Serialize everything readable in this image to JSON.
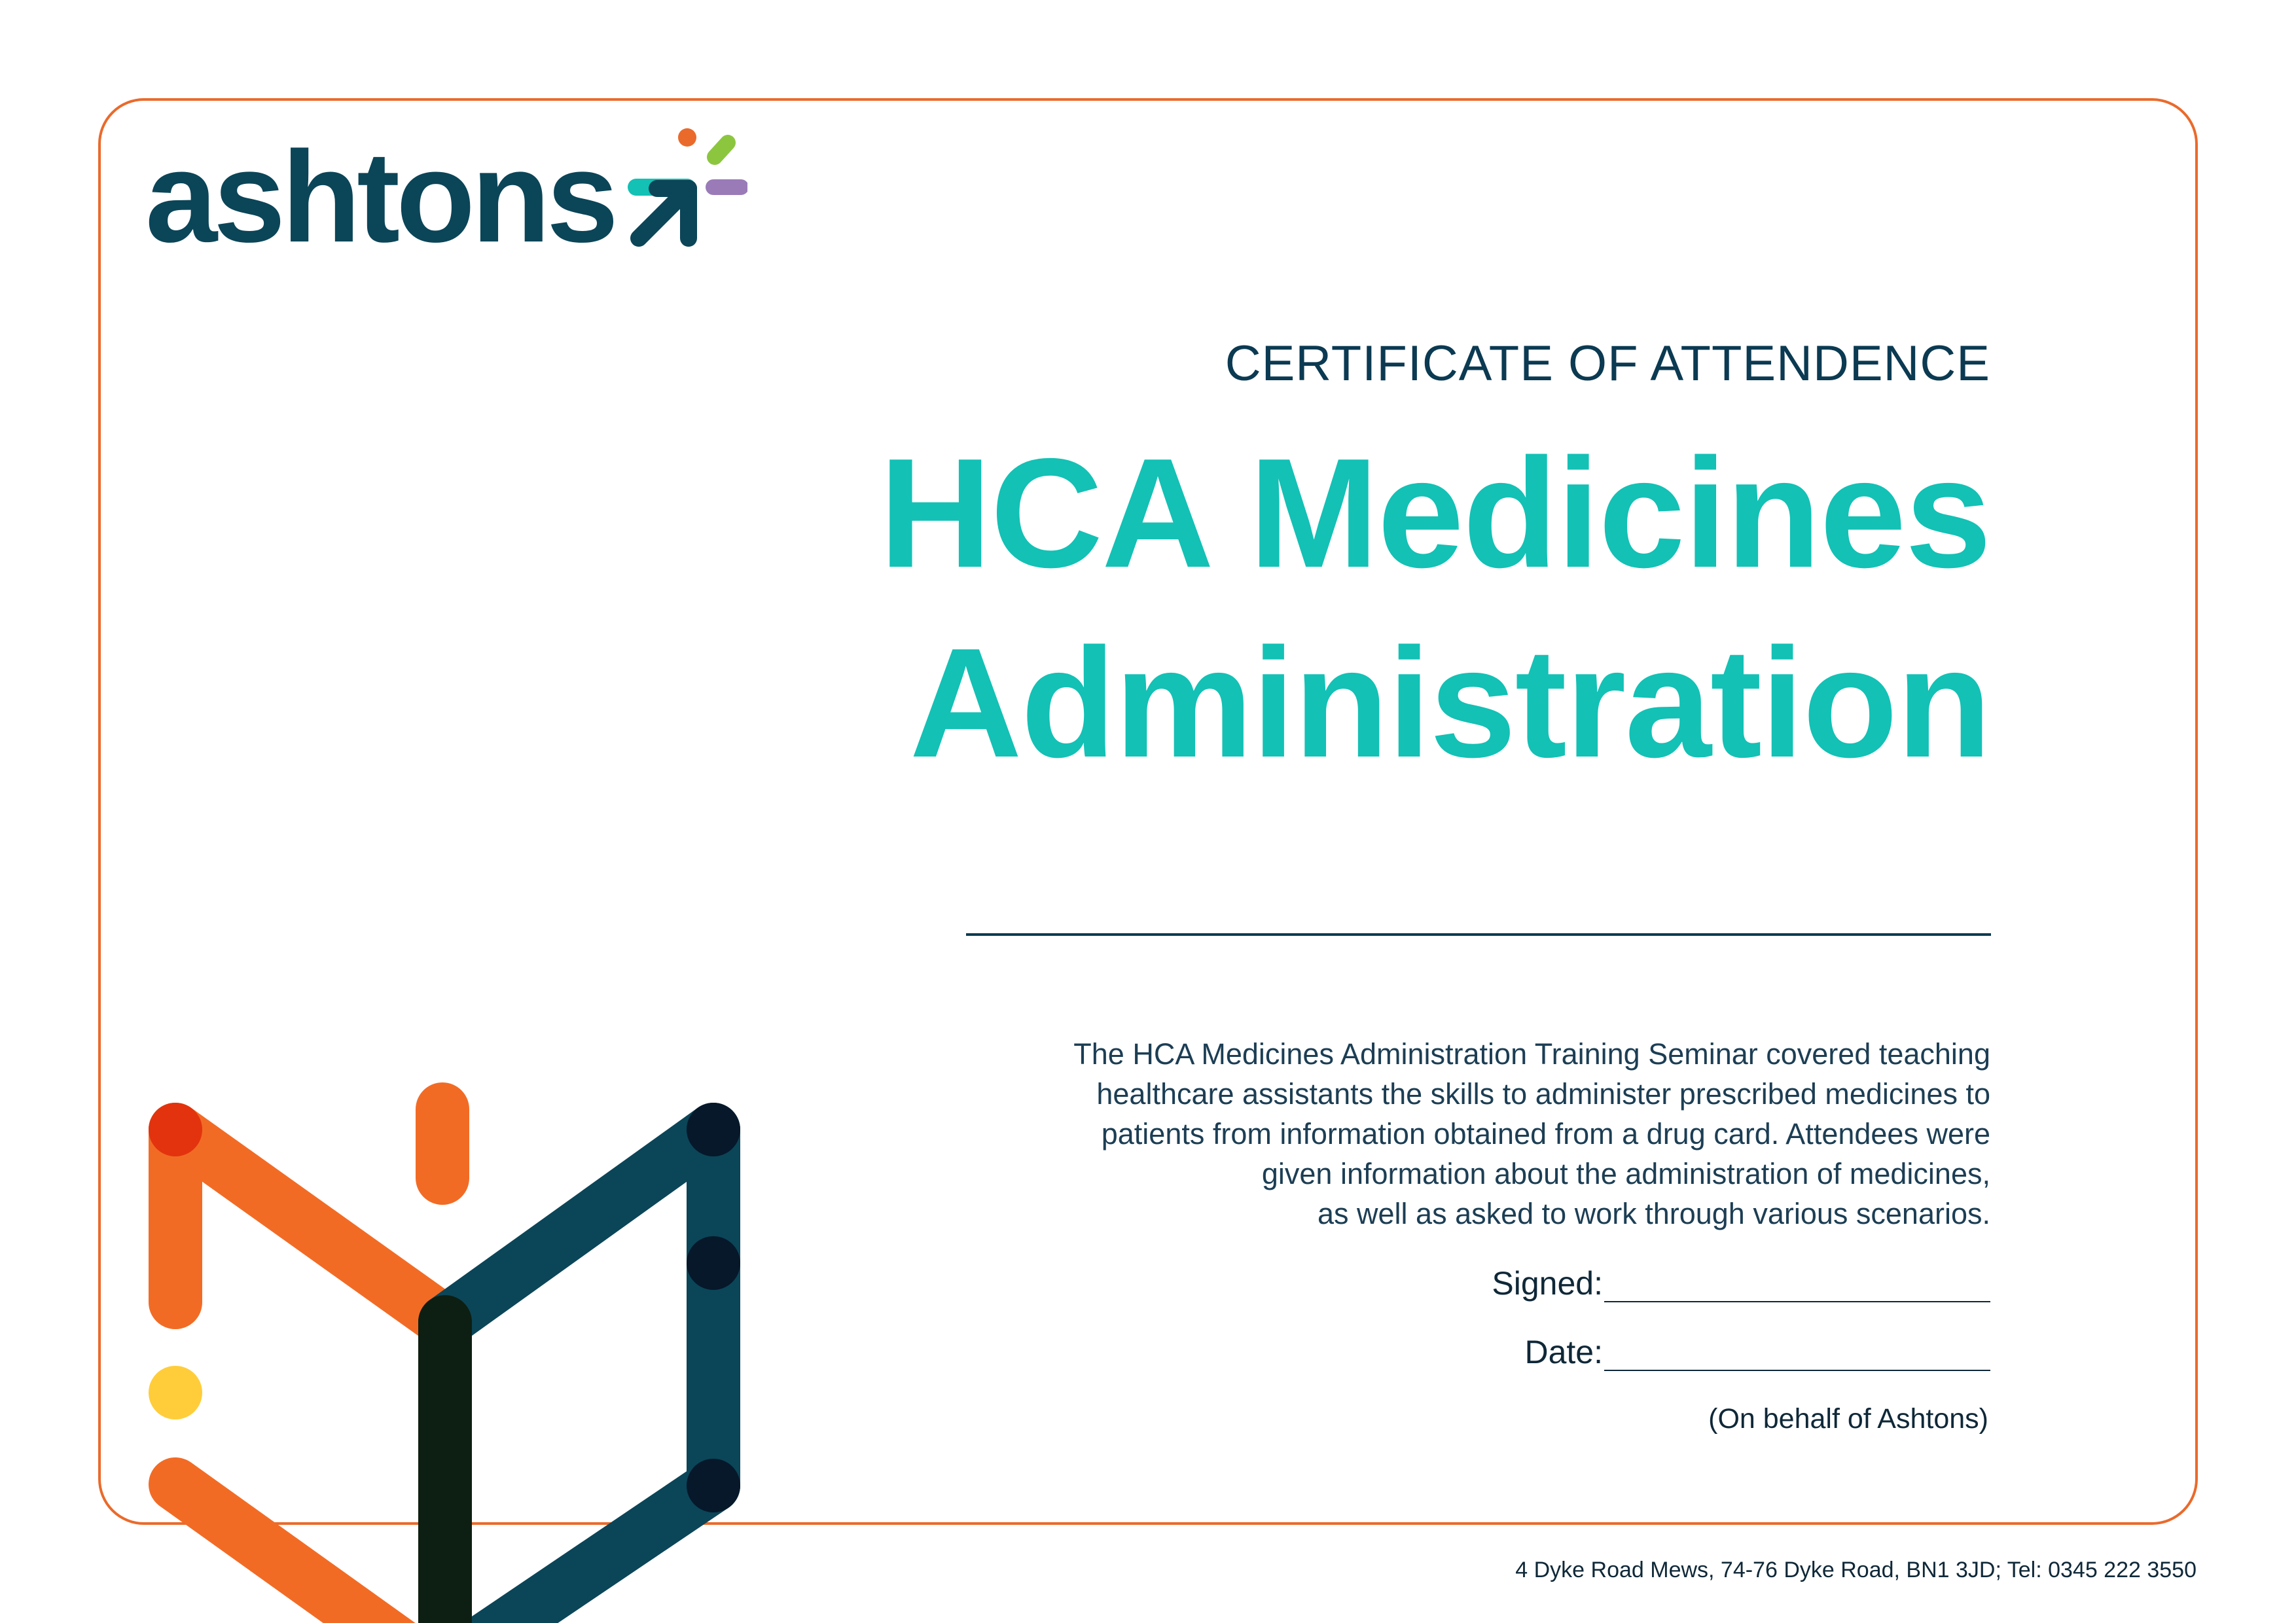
{
  "brand": {
    "logo_text": "ashtons",
    "colors": {
      "navy": "#0b4558",
      "teal": "#13c1b5",
      "orange": "#ea6a2b",
      "lime": "#8cc63f",
      "purple": "#9a7bb8",
      "yellow": "#ffcd3a"
    }
  },
  "certificate": {
    "subtitle": "CERTIFICATE OF ATTENDENCE",
    "title_line1": "HCA Medicines",
    "title_line2": "Administration",
    "description": [
      "The HCA Medicines Administration Training Seminar covered teaching",
      "healthcare assistants the skills to administer prescribed medicines to",
      "patients from information obtained from a drug card. Attendees were",
      "given information about the administration of medicines,",
      "as well as asked to work through various scenarios."
    ],
    "signed_label": "Signed:",
    "date_label": "Date:",
    "on_behalf": "(On behalf of Ashtons)"
  },
  "footer": {
    "address": "4 Dyke Road Mews, 74-76 Dyke Road, BN1 3JD; Tel: 0345 222 3550"
  }
}
